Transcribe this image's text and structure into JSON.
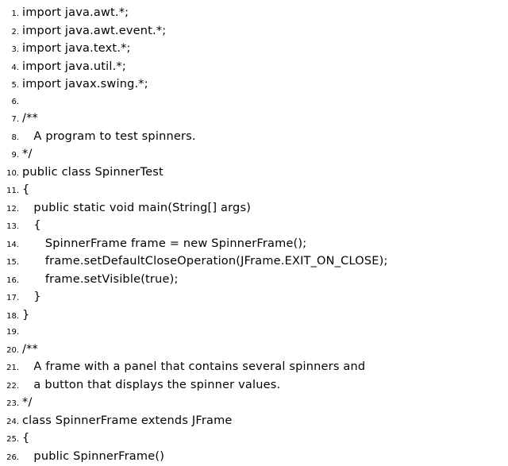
{
  "lines": [
    {
      "n": "1.",
      "text": "import java.awt.*;"
    },
    {
      "n": "2.",
      "text": "import java.awt.event.*;"
    },
    {
      "n": "3.",
      "text": "import java.text.*;"
    },
    {
      "n": "4.",
      "text": "import java.util.*;"
    },
    {
      "n": "5.",
      "text": "import javax.swing.*;"
    },
    {
      "n": "6.",
      "text": ""
    },
    {
      "n": "7.",
      "text": "/**"
    },
    {
      "n": "8.",
      "text": "   A program to test spinners."
    },
    {
      "n": "9.",
      "text": "*/"
    },
    {
      "n": "10.",
      "text": "public class SpinnerTest"
    },
    {
      "n": "11.",
      "text": "{"
    },
    {
      "n": "12.",
      "text": "   public static void main(String[] args)"
    },
    {
      "n": "13.",
      "text": "   {"
    },
    {
      "n": "14.",
      "text": "      SpinnerFrame frame = new SpinnerFrame();"
    },
    {
      "n": "15.",
      "text": "      frame.setDefaultCloseOperation(JFrame.EXIT_ON_CLOSE);"
    },
    {
      "n": "16.",
      "text": "      frame.setVisible(true);"
    },
    {
      "n": "17.",
      "text": "   }"
    },
    {
      "n": "18.",
      "text": "}"
    },
    {
      "n": "19.",
      "text": ""
    },
    {
      "n": "20.",
      "text": "/**"
    },
    {
      "n": "21.",
      "text": "   A frame with a panel that contains several spinners and"
    },
    {
      "n": "22.",
      "text": "   a button that displays the spinner values."
    },
    {
      "n": "23.",
      "text": "*/"
    },
    {
      "n": "24.",
      "text": "class SpinnerFrame extends JFrame"
    },
    {
      "n": "25.",
      "text": "{"
    },
    {
      "n": "26.",
      "text": "   public SpinnerFrame()"
    }
  ]
}
